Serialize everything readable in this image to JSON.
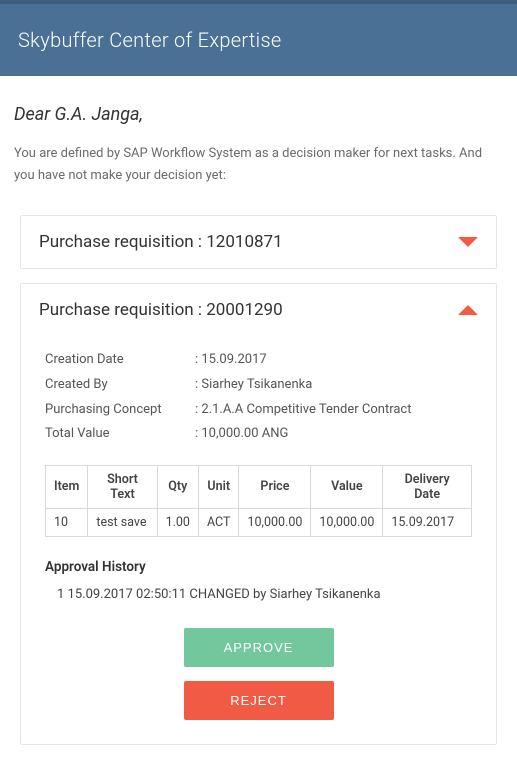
{
  "header": {
    "title": "Skybuffer Center of Expertise"
  },
  "greeting": "Dear G.A. Janga,",
  "intro": "You are defined by SAP Workflow System as a decision maker for next tasks. And you have not make your decision yet:",
  "requisitions": [
    {
      "title": "Purchase requisition : 12010871",
      "expanded": false
    },
    {
      "title": "Purchase requisition : 20001290",
      "expanded": true,
      "meta": {
        "creation_date_label": "Creation Date",
        "creation_date_value": ": 15.09.2017",
        "created_by_label": "Created By",
        "created_by_value": ": Siarhey Tsikanenka",
        "purchasing_concept_label": "Purchasing Concept",
        "purchasing_concept_value": ": 2.1.A.A Competitive Tender Contract",
        "total_value_label": "Total Value",
        "total_value_value": ": 10,000.00 ANG"
      },
      "table": {
        "headers": {
          "item": "Item",
          "short_text": "Short Text",
          "qty": "Qty",
          "unit": "Unit",
          "price": "Price",
          "value": "Value",
          "delivery_date": "Delivery Date"
        },
        "rows": [
          {
            "item": "10",
            "short_text": "test save",
            "qty": "1.00",
            "unit": "ACT",
            "price": "10,000.00",
            "value": "10,000.00",
            "delivery_date": "15.09.2017"
          }
        ]
      },
      "approval_history_title": "Approval History",
      "approval_history": [
        "1 15.09.2017 02:50:11 CHANGED by Siarhey Tsikanenka"
      ],
      "actions": {
        "approve": "APPROVE",
        "reject": "REJECT"
      }
    }
  ]
}
